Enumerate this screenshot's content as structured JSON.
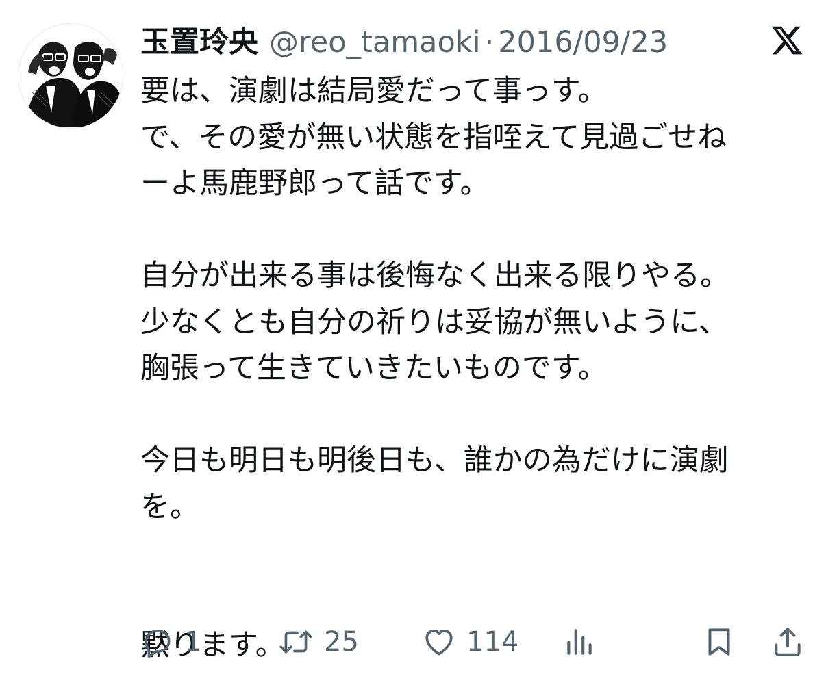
{
  "header": {
    "display_name": "玉置玲央",
    "handle": "@reo_tamaoki",
    "separator": "·",
    "date": "2016/09/23"
  },
  "tweet": {
    "lines": [
      "要は、演劇は結局愛だって事っす。",
      "で、その愛が無い状態を指咥えて見過ごせね",
      "ーよ馬鹿野郎って話です。",
      "",
      "自分が出来る事は後悔なく出来る限りやる。",
      "少なくとも自分の祈りは妥協が無いように、",
      "胸張って生きていきたいものです。",
      "",
      "今日も明日も明後日も、誰かの為だけに演劇",
      "を。",
      "",
      "",
      "黙ります。"
    ]
  },
  "actions": {
    "reply_count": "1",
    "retweet_count": "25",
    "like_count": "114"
  },
  "icons": {
    "avatar": "manga-duo-avatar",
    "brand": "x-logo-icon",
    "reply": "reply-icon",
    "retweet": "retweet-icon",
    "like": "heart-icon",
    "views": "analytics-icon",
    "bookmark": "bookmark-icon",
    "share": "share-icon"
  },
  "colors": {
    "text": "#0f1419",
    "secondary": "#536471",
    "background": "#ffffff"
  }
}
